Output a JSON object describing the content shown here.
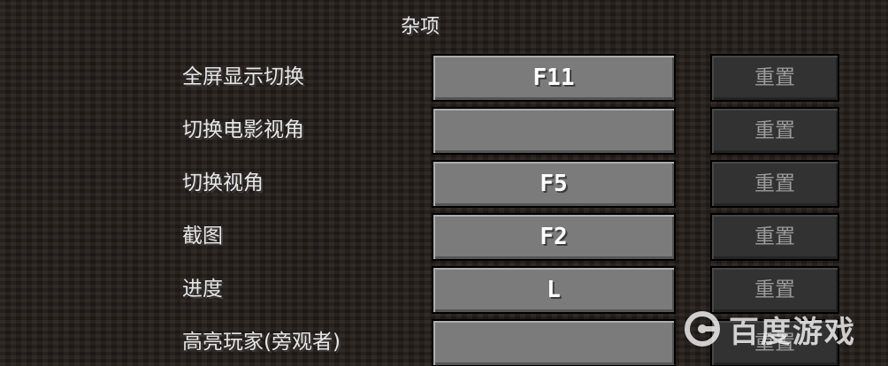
{
  "section": {
    "title": "杂项"
  },
  "keybinds": [
    {
      "label": "全屏显示切换",
      "key": "F11",
      "reset": "重置"
    },
    {
      "label": "切换电影视角",
      "key": "",
      "reset": "重置"
    },
    {
      "label": "切换视角",
      "key": "F5",
      "reset": "重置"
    },
    {
      "label": "截图",
      "key": "F2",
      "reset": "重置"
    },
    {
      "label": "进度",
      "key": "L",
      "reset": "重置"
    },
    {
      "label": "高亮玩家(旁观者)",
      "key": "",
      "reset": "重置"
    }
  ],
  "watermark": {
    "text": "百度游戏",
    "icon": "baidu-game-logo-icon"
  },
  "colors": {
    "background": "#221c19",
    "key_button": "#7b7b7b",
    "reset_button_disabled": "#323232",
    "label_text": "#e6e6e6"
  }
}
